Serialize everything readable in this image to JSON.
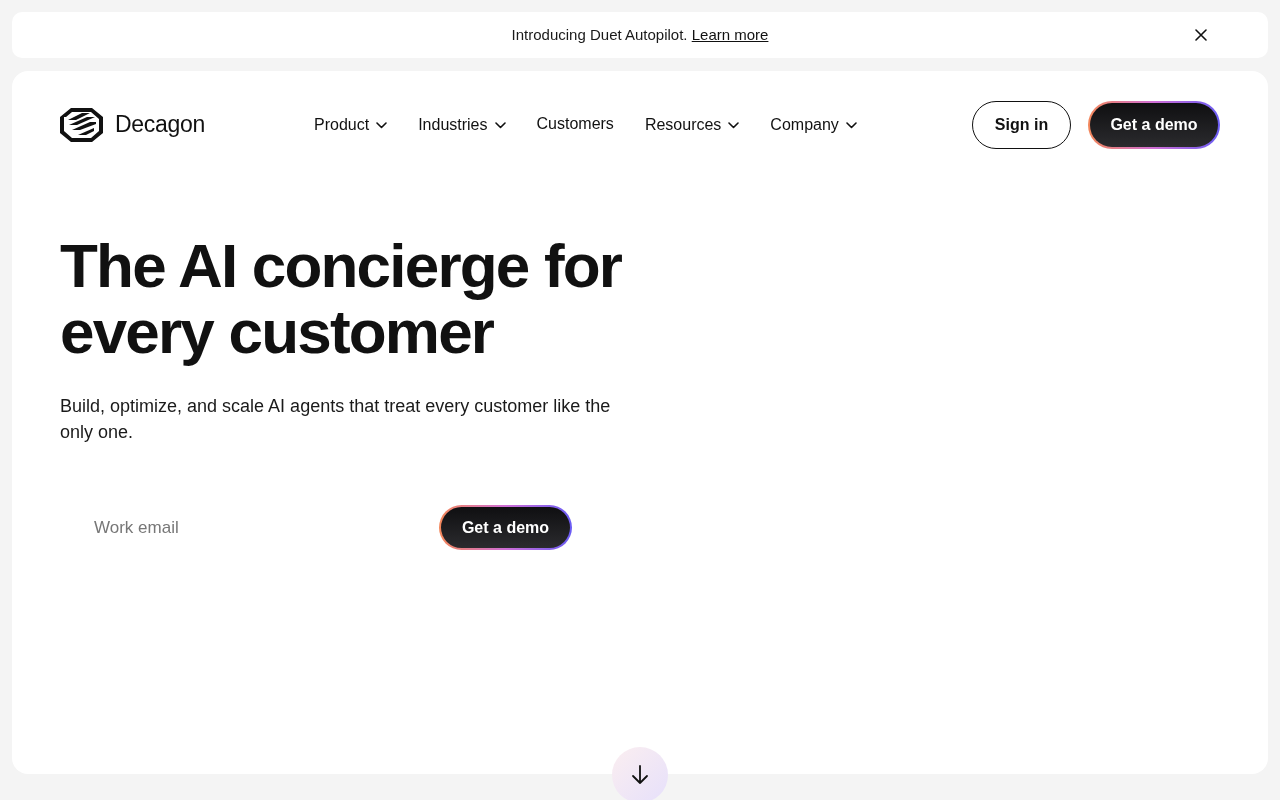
{
  "banner": {
    "text": "Introducing Duet Autopilot.",
    "link": "Learn more"
  },
  "nav": {
    "brand": "Decagon",
    "items": [
      {
        "label": "Product",
        "has_menu": true
      },
      {
        "label": "Industries",
        "has_menu": true
      },
      {
        "label": "Customers",
        "has_menu": false
      },
      {
        "label": "Resources",
        "has_menu": true
      },
      {
        "label": "Company",
        "has_menu": true
      }
    ],
    "sign_in": "Sign in",
    "cta": "Get a demo"
  },
  "hero": {
    "title": "The AI concierge for every customer",
    "subtitle": "Build, optimize, and scale AI agents that treat every customer like the only one.",
    "email": {
      "placeholder": "Work email"
    },
    "cta": "Get a demo"
  }
}
